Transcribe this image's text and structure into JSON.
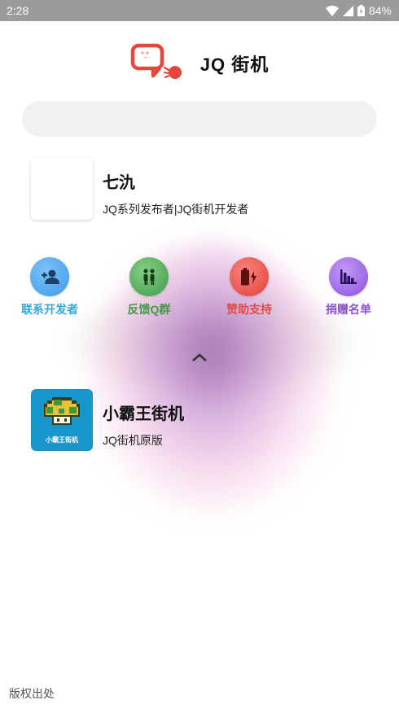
{
  "status_bar": {
    "time": "2:28",
    "battery": "84%",
    "icons": [
      "wifi-icon",
      "signal-icon",
      "battery-icon"
    ]
  },
  "header": {
    "title": "JQ 街机",
    "logo_icon": "chat-bubble-logo",
    "logo_color": "#e8463c"
  },
  "search": {
    "placeholder": ""
  },
  "developer": {
    "name": "七氿",
    "description": "JQ系列发布者|JQ街机开发者"
  },
  "actions": [
    {
      "label": "联系开发者",
      "icon": "add-contact-icon",
      "color": "#2ea7dc",
      "circle": "#4aa8ef"
    },
    {
      "label": "反馈Q群",
      "icon": "people-icon",
      "color": "#3f9a45",
      "circle": "#4aa54f"
    },
    {
      "label": "赞助支持",
      "icon": "battery-charge-icon",
      "color": "#e34a42",
      "circle": "#ee4c44"
    },
    {
      "label": "捐赠名单",
      "icon": "bar-chart-icon",
      "color": "#8a4fd6",
      "circle": "#9a5ce8"
    }
  ],
  "collapse_icon": "chevron-up-icon",
  "games": [
    {
      "name": "小霸王街机",
      "description": "JQ街机原版",
      "thumb_text": "小霸王街机"
    }
  ],
  "footer": {
    "copyright_label": "版权出处"
  }
}
